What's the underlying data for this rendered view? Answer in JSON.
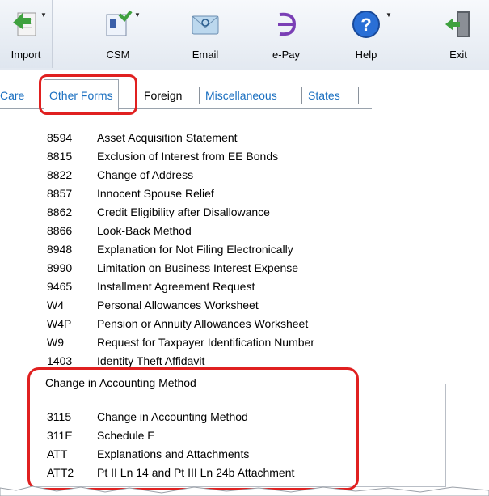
{
  "toolbar": {
    "buttons": [
      {
        "label": "Import",
        "icon": "import-icon"
      },
      {
        "label": "CSM",
        "icon": "csm-icon"
      },
      {
        "label": "Email",
        "icon": "email-icon"
      },
      {
        "label": "e-Pay",
        "icon": "epay-icon"
      },
      {
        "label": "Help",
        "icon": "help-icon"
      },
      {
        "label": "Exit",
        "icon": "exit-icon"
      }
    ]
  },
  "tabs": [
    {
      "label": "Care"
    },
    {
      "label": "Other Forms",
      "active": true
    },
    {
      "label": "Foreign"
    },
    {
      "label": "Miscellaneous"
    },
    {
      "label": "States"
    }
  ],
  "forms": [
    {
      "code": "8594",
      "desc": "Asset Acquisition Statement"
    },
    {
      "code": "8815",
      "desc": "Exclusion of Interest from EE Bonds"
    },
    {
      "code": "8822",
      "desc": "Change of Address"
    },
    {
      "code": "8857",
      "desc": "Innocent Spouse Relief"
    },
    {
      "code": "8862",
      "desc": "Credit Eligibility after Disallowance"
    },
    {
      "code": "8866",
      "desc": "Look-Back Method"
    },
    {
      "code": "8948",
      "desc": "Explanation for Not Filing Electronically"
    },
    {
      "code": "8990",
      "desc": "Limitation on Business Interest Expense"
    },
    {
      "code": "9465",
      "desc": "Installment Agreement Request"
    },
    {
      "code": "W4",
      "desc": "Personal Allowances Worksheet"
    },
    {
      "code": "W4P",
      "desc": "Pension or Annuity Allowances Worksheet"
    },
    {
      "code": "W9",
      "desc": "Request for Taxpayer Identification Number"
    },
    {
      "code": "1403",
      "desc": "Identity Theft Affidavit"
    }
  ],
  "group": {
    "title": "Change in Accounting Method",
    "forms": [
      {
        "code": "3115",
        "desc": "Change in Accounting Method"
      },
      {
        "code": "311E",
        "desc": "Schedule E"
      },
      {
        "code": "ATT",
        "desc": "Explanations and Attachments"
      },
      {
        "code": "ATT2",
        "desc": "Pt II Ln 14 and Pt III Ln 24b Attachment"
      }
    ]
  },
  "colors": {
    "highlight": "#e02020",
    "link": "#1a6fc0"
  }
}
